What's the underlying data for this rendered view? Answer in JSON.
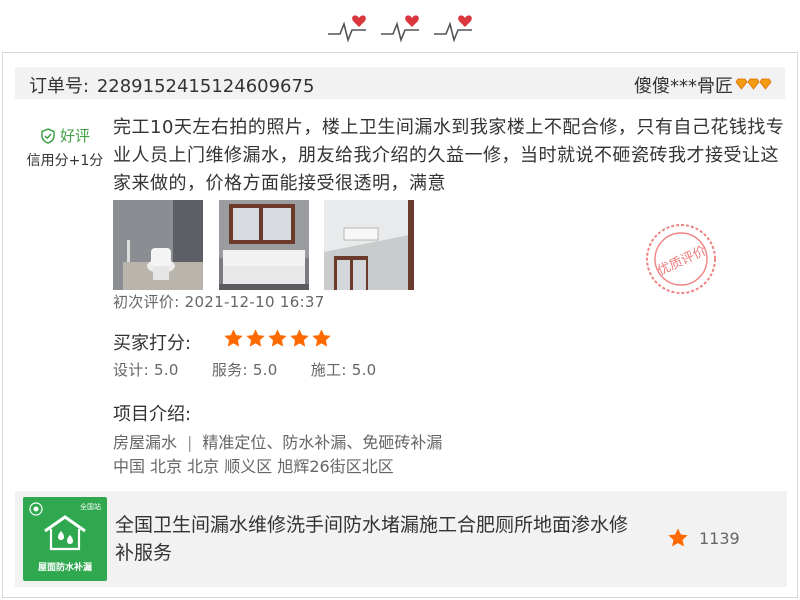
{
  "theme": {
    "accent_green": "#43a047",
    "star_orange": "#ff6a00",
    "stamp_red": "#e85a5a",
    "heart_red": "#d9363e"
  },
  "header_icon": "heartbeat-hearts-icon",
  "order": {
    "label": "订单号:",
    "number": "2289152415124609675"
  },
  "reviewer": {
    "name": "傻傻***骨匠",
    "level_icon": "diamond-icon"
  },
  "badge": {
    "icon": "shield-check-icon",
    "label": "好评",
    "credit": "信用分+1分"
  },
  "review": {
    "text": "完工10天左右拍的照片，楼上卫生间漏水到我家楼上不配合修，只有自己花钱找专业人员上门维修漏水，朋友给我介绍的久益一修，当时就说不砸瓷砖我才接受让这家来做的，价格方面能接受很透明，满意",
    "first_review": "初次评价: 2021-12-10 16:37",
    "stamp_text": "优质评价"
  },
  "rating": {
    "label": "买家打分:",
    "stars": 5,
    "design": "设计: 5.0",
    "service": "服务: 5.0",
    "construction": "施工: 5.0"
  },
  "project": {
    "title": "项目介绍:",
    "category": "房屋漏水",
    "separator": "|",
    "features": "精准定位、防水补漏、免砸砖补漏",
    "location": "中国 北京 北京 顺义区 旭辉26街区北区"
  },
  "service": {
    "thumb_tag": "全国站",
    "thumb_text": "屋面防水补漏",
    "title": "全国卫生间漏水维修洗手间防水堵漏施工合肥厕所地面渗水修补服务",
    "likes": "1139",
    "like_icon": "star-icon"
  }
}
